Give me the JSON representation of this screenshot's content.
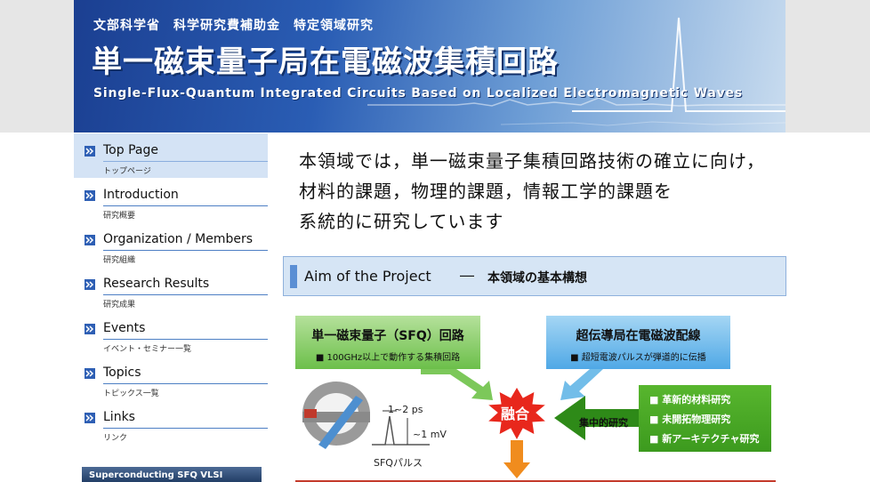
{
  "header": {
    "subtitle": "文部科学省　科学研究費補助金　特定領域研究",
    "title": "単一磁束量子局在電磁波集積回路",
    "title_en": "Single-Flux-Quantum Integrated Circuits Based on Localized Electromagnetic Waves"
  },
  "nav": {
    "items": [
      {
        "en": "Top Page",
        "ja": "トップページ",
        "active": true
      },
      {
        "en": "Introduction",
        "ja": "研究概要"
      },
      {
        "en": "Organization / Members",
        "ja": "研究組織"
      },
      {
        "en": "Research Results",
        "ja": "研究成果"
      },
      {
        "en": "Events",
        "ja": "イベント・セミナー一覧"
      },
      {
        "en": "Topics",
        "ja": "トピックス一覧"
      },
      {
        "en": "Links",
        "ja": "リンク"
      }
    ],
    "bottom_banner": "Superconducting SFQ VLSI"
  },
  "intro": {
    "line1": "本領域では，単一磁束量子集積回路技術の確立に向け，",
    "line2": "材料的課題，物理的課題，情報工学的課題を",
    "line3": "系統的に研究しています"
  },
  "aim": {
    "title": "Aim of the Project",
    "dash": "―",
    "title_ja": "本領域の基本構想"
  },
  "diagram": {
    "sfq_heading": "単一磁束量子（SFQ）回路",
    "sfq_sub": "■ 100GHz以上で動作する集積回路",
    "em_heading": "超伝導局在電磁波配線",
    "em_sub": "■ 超短電波パルスが弾道的に伝播",
    "pulse_time": "1~2 ps",
    "pulse_voltage": "~1 mV",
    "pulse_label": "SFQパルス",
    "fusion": "融合",
    "concentrated": "集中的研究",
    "research": [
      "■ 革新的材料研究",
      "■ 未開拓物理研究",
      "■ 新アーキテクチャ研究"
    ],
    "colors": {
      "green": "#6cbf4a",
      "blue": "#4fa8e6",
      "red": "#e8271c",
      "orange": "#f08c1e"
    }
  }
}
